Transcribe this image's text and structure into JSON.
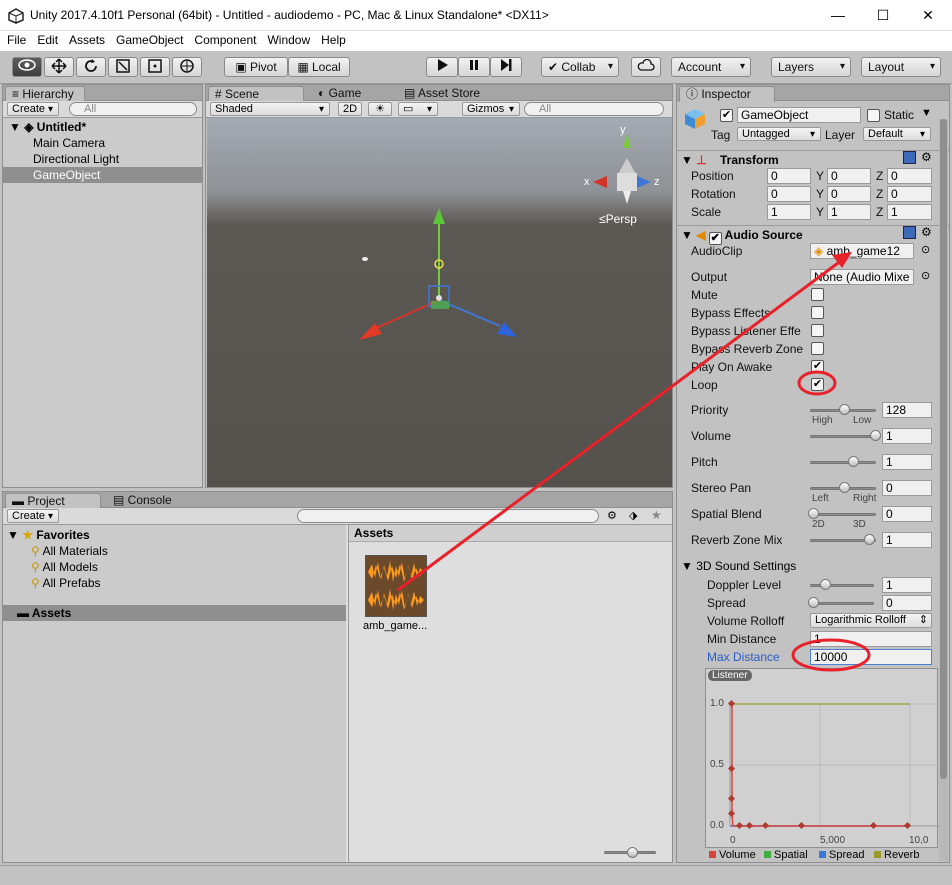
{
  "window": {
    "title": "Unity 2017.4.10f1 Personal (64bit) - Untitled - audiodemo - PC, Mac & Linux Standalone* <DX11>",
    "minimize": "—",
    "maximize": "☐",
    "close": "✕"
  },
  "menu": [
    "File",
    "Edit",
    "Assets",
    "GameObject",
    "Component",
    "Window",
    "Help"
  ],
  "toolbar": {
    "pivot": "Pivot",
    "local": "Local",
    "collab": "Collab",
    "account": "Account",
    "layers": "Layers",
    "layout": "Layout"
  },
  "hierarchy": {
    "tab": "Hierarchy",
    "create": "Create",
    "search_placeholder": "All",
    "scene": "Untitled*",
    "items": [
      "Main Camera",
      "Directional Light",
      "GameObject"
    ]
  },
  "scene": {
    "tabs": [
      "Scene",
      "Game",
      "Asset Store"
    ],
    "shaded": "Shaded",
    "mode2d": "2D",
    "gizmos": "Gizmos",
    "search_placeholder": "All",
    "persp": "Persp",
    "axis_y": "y",
    "axis_x": "x",
    "axis_z": "z"
  },
  "project": {
    "tabs": [
      "Project",
      "Console"
    ],
    "create": "Create",
    "favorites": "Favorites",
    "fav_items": [
      "All Materials",
      "All Models",
      "All Prefabs"
    ],
    "assets_folder": "Assets",
    "assets_header": "Assets",
    "asset_name": "amb_game..."
  },
  "inspector": {
    "tab": "Inspector",
    "object_name": "GameObject",
    "static": "Static",
    "tag_label": "Tag",
    "tag": "Untagged",
    "layer_label": "Layer",
    "layer": "Default",
    "transform": {
      "title": "Transform",
      "rows": [
        {
          "label": "Position",
          "x": "0",
          "y": "0",
          "z": "0"
        },
        {
          "label": "Rotation",
          "x": "0",
          "y": "0",
          "z": "0"
        },
        {
          "label": "Scale",
          "x": "1",
          "y": "1",
          "z": "1"
        }
      ]
    },
    "audio": {
      "title": "Audio Source",
      "clip_label": "AudioClip",
      "clip": "amb_game12",
      "output_label": "Output",
      "output": "None (Audio Mixe",
      "checks": [
        {
          "label": "Mute",
          "checked": false
        },
        {
          "label": "Bypass Effects",
          "checked": false
        },
        {
          "label": "Bypass Listener Effe",
          "checked": false
        },
        {
          "label": "Bypass Reverb Zone",
          "checked": false
        },
        {
          "label": "Play On Awake",
          "checked": true
        },
        {
          "label": "Loop",
          "checked": true
        }
      ],
      "sliders": [
        {
          "label": "Priority",
          "value": "128",
          "pos": 0.5,
          "low": "High",
          "high": "Low"
        },
        {
          "label": "Volume",
          "value": "1",
          "pos": 1.0
        },
        {
          "label": "Pitch",
          "value": "1",
          "pos": 0.65
        },
        {
          "label": "Stereo Pan",
          "value": "0",
          "pos": 0.5,
          "low": "Left",
          "high": "Right"
        },
        {
          "label": "Spatial Blend",
          "value": "0",
          "pos": 0.0,
          "low": "2D",
          "high": "3D"
        },
        {
          "label": "Reverb Zone Mix",
          "value": "1",
          "pos": 0.9
        }
      ]
    },
    "sound3d": {
      "title": "3D Sound Settings",
      "doppler_label": "Doppler Level",
      "doppler": "1",
      "doppler_pos": 0.2,
      "spread_label": "Spread",
      "spread": "0",
      "spread_pos": 0.0,
      "rolloff_label": "Volume Rolloff",
      "rolloff": "Logarithmic Rolloff",
      "min_label": "Min Distance",
      "min": "1",
      "max_label": "Max Distance",
      "max": "10000"
    },
    "graph": {
      "listener": "Listener",
      "y_ticks": [
        "1.0",
        "0.5",
        "0.0"
      ],
      "x_ticks": [
        "0",
        "5,000",
        "10,0"
      ],
      "legend": [
        {
          "name": "Volume",
          "color": "#d9443a"
        },
        {
          "name": "Spatial",
          "color": "#3fae3f"
        },
        {
          "name": "Spread",
          "color": "#3c78d8"
        },
        {
          "name": "Reverb",
          "color": "#9a9a2a"
        }
      ]
    }
  }
}
